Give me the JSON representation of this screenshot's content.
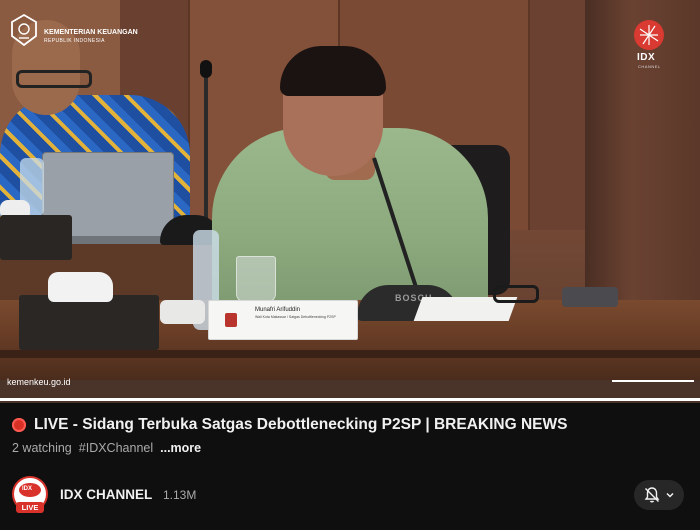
{
  "video": {
    "overlay_logo_left": {
      "icon": "kemenkeu-emblem-icon",
      "name": "KEMENTERIAN KEUANGAN",
      "subtitle": "REPUBLIK INDONESIA"
    },
    "overlay_logo_right": {
      "icon": "idx-channel-logo-icon",
      "name": "IDX",
      "subtitle": "CHANNEL"
    },
    "nameplate": {
      "name": "Munafri Arifuddin",
      "title": "Wali Kota Makassar / Satgas Debottlenecking P2SP"
    },
    "mic_brand": "BOSCH",
    "source_watermark": "kemenkeu.go.id",
    "progress_fraction": 1.0
  },
  "info": {
    "live_icon": "live-red-dot-icon",
    "title": "LIVE - Sidang Terbuka Satgas Debottlenecking P2SP | BREAKING NEWS",
    "watching": "2 watching",
    "hashtag": "#IDXChannel",
    "more": "...more"
  },
  "channel": {
    "avatar_text": "IDX",
    "live_badge": "LIVE",
    "name": "IDX CHANNEL",
    "subscribers": "1.13M",
    "notify_icon": "bell-off-icon",
    "notify_menu_icon": "chevron-down-icon"
  },
  "colors": {
    "background": "#0f0f0f",
    "live_red": "#d93025",
    "text_primary": "#f1f1f1",
    "text_secondary": "#aaaaaa"
  }
}
